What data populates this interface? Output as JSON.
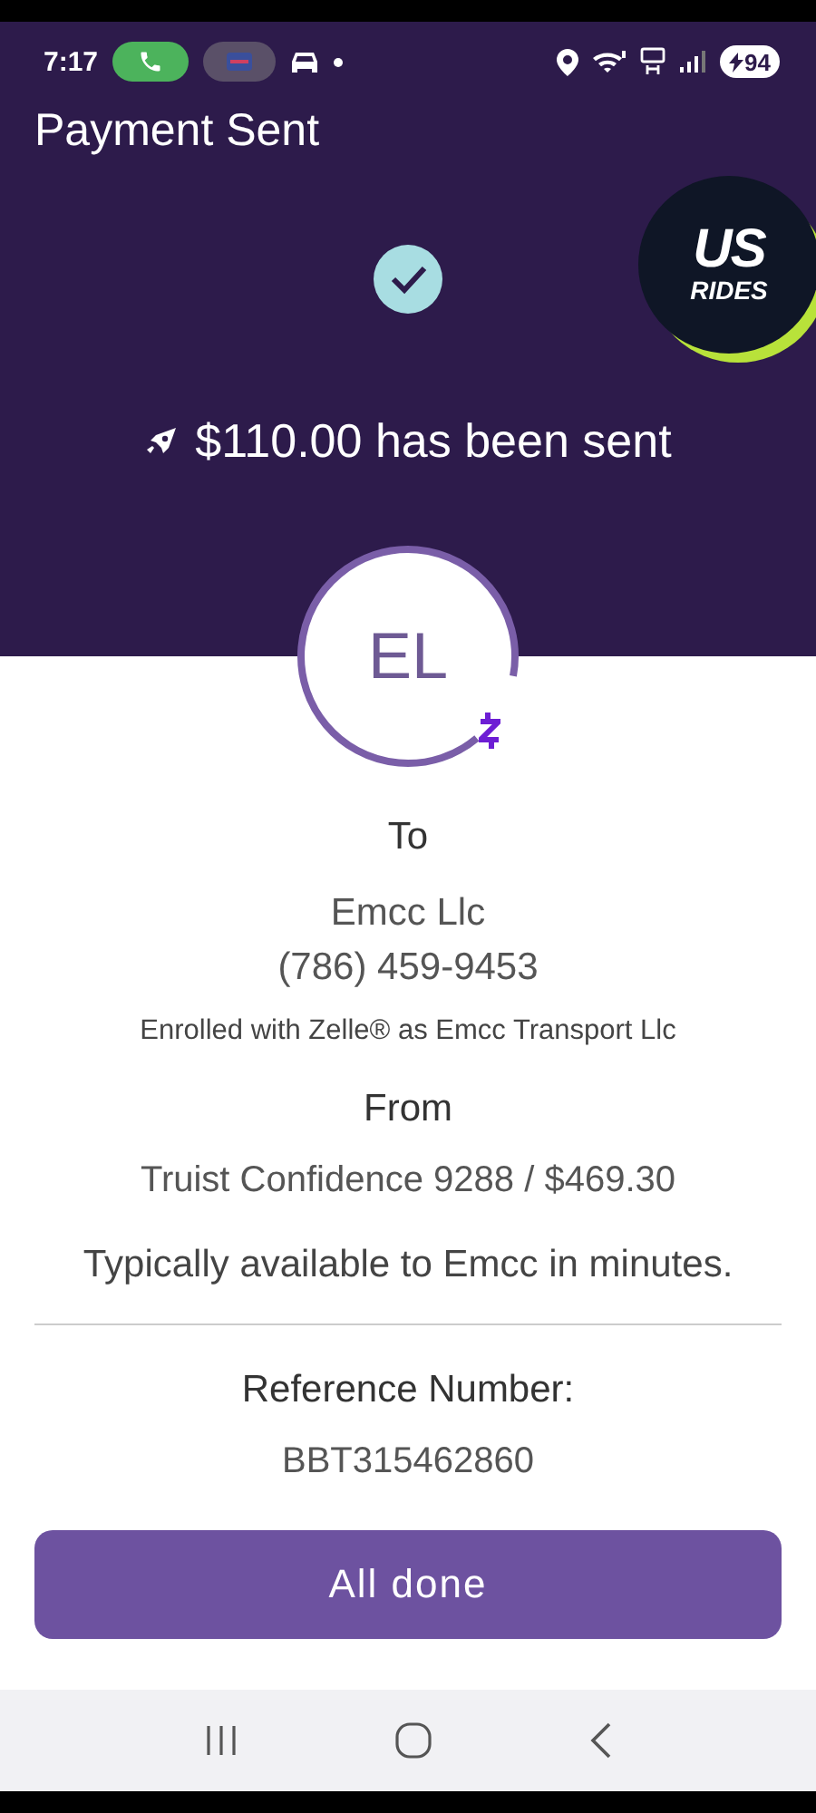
{
  "status_bar": {
    "time": "7:17",
    "battery": "94"
  },
  "header": {
    "title": "Payment Sent",
    "logo": {
      "line_1": "US",
      "line_2": "RIDES"
    },
    "message": "$110.00 has been sent"
  },
  "recipient": {
    "initials": "EL",
    "label": "To",
    "name": "Emcc Llc",
    "phone": "(786) 459-9453",
    "enrolled": "Enrolled with Zelle® as Emcc Transport Llc"
  },
  "source": {
    "label": "From",
    "account": "Truist Confidence 9288 / $469.30"
  },
  "availability": "Typically available to Emcc in minutes.",
  "reference": {
    "label": "Reference Number:",
    "number": "BBT315462860"
  },
  "button": "All done"
}
